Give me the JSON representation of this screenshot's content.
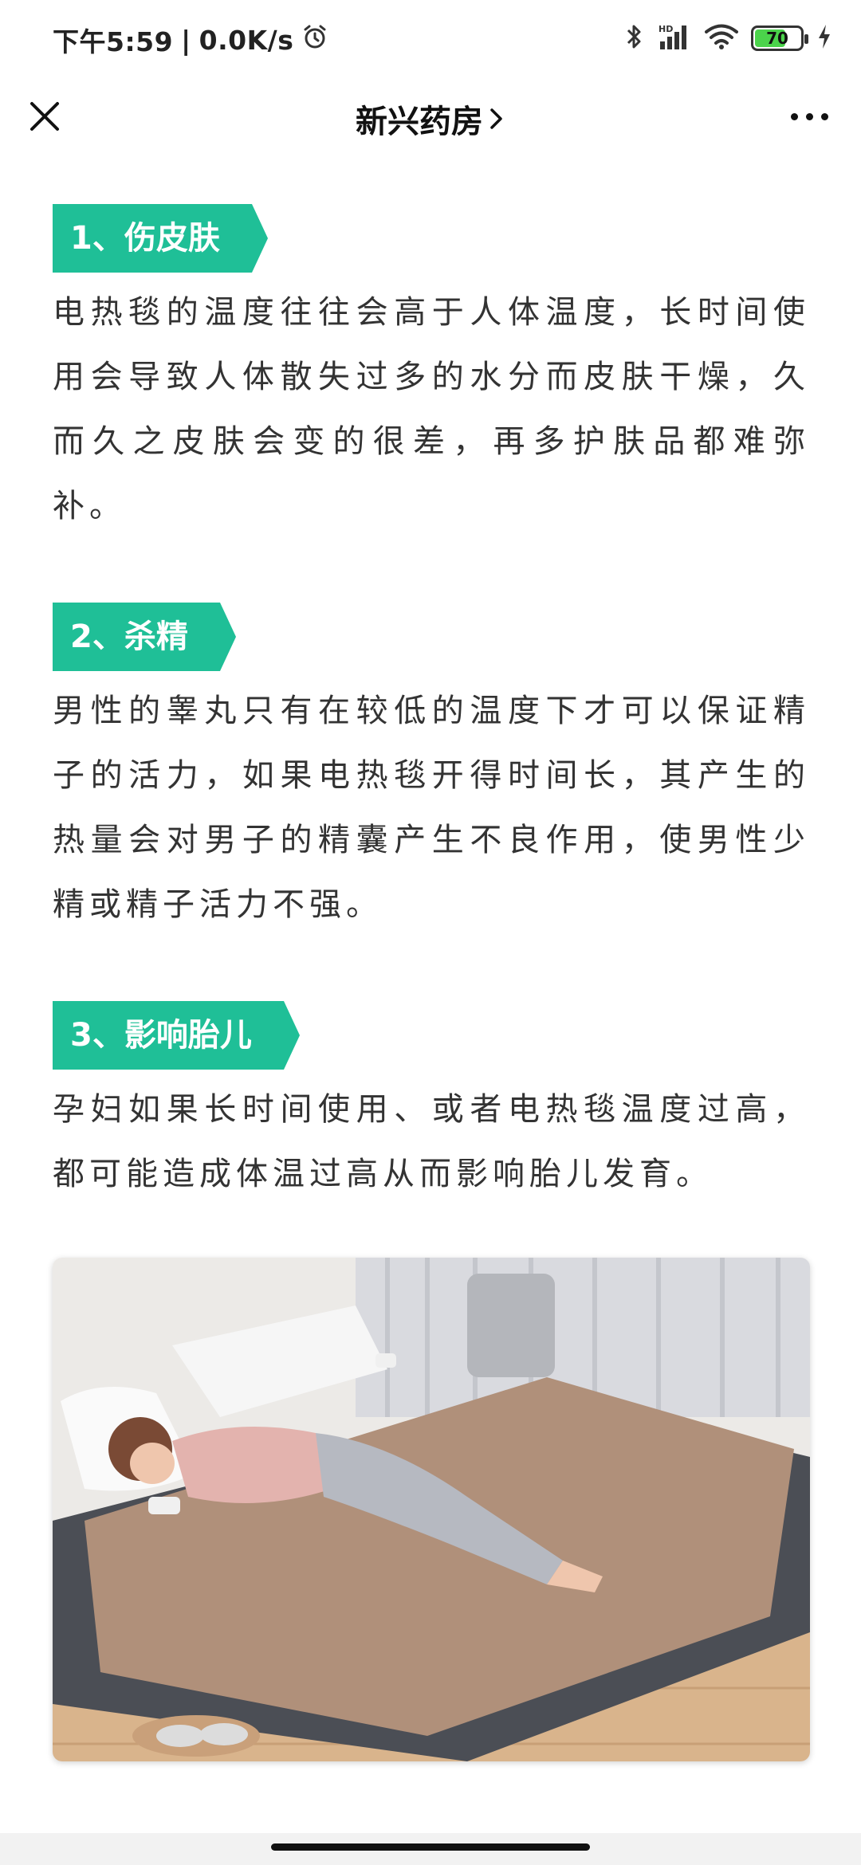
{
  "status": {
    "time": "下午5:59",
    "speed": "0.0K/s",
    "battery": "70",
    "battery_level": 0.7
  },
  "nav": {
    "title": "新兴药房"
  },
  "sections": [
    {
      "tag": "1、伤皮肤",
      "text": "电热毯的温度往往会高于人体温度，长时间使用会导致人体散失过多的水分而皮肤干燥，久而久之皮肤会变的很差，再多护肤品都难弥补。"
    },
    {
      "tag": "2、杀精",
      "text": "男性的睾丸只有在较低的温度下才可以保证精子的活力，如果电热毯开得时间长，其产生的热量会对男子的精囊产生不良作用，使男性少精或精子活力不强。"
    },
    {
      "tag": "3、影响胎儿",
      "text": "孕妇如果长时间使用、或者电热毯温度过高，都可能造成体温过高从而影响胎儿发育。"
    }
  ],
  "colors": {
    "tag_bg": "#1fbf97",
    "battery_fill": "#4bd34b"
  }
}
